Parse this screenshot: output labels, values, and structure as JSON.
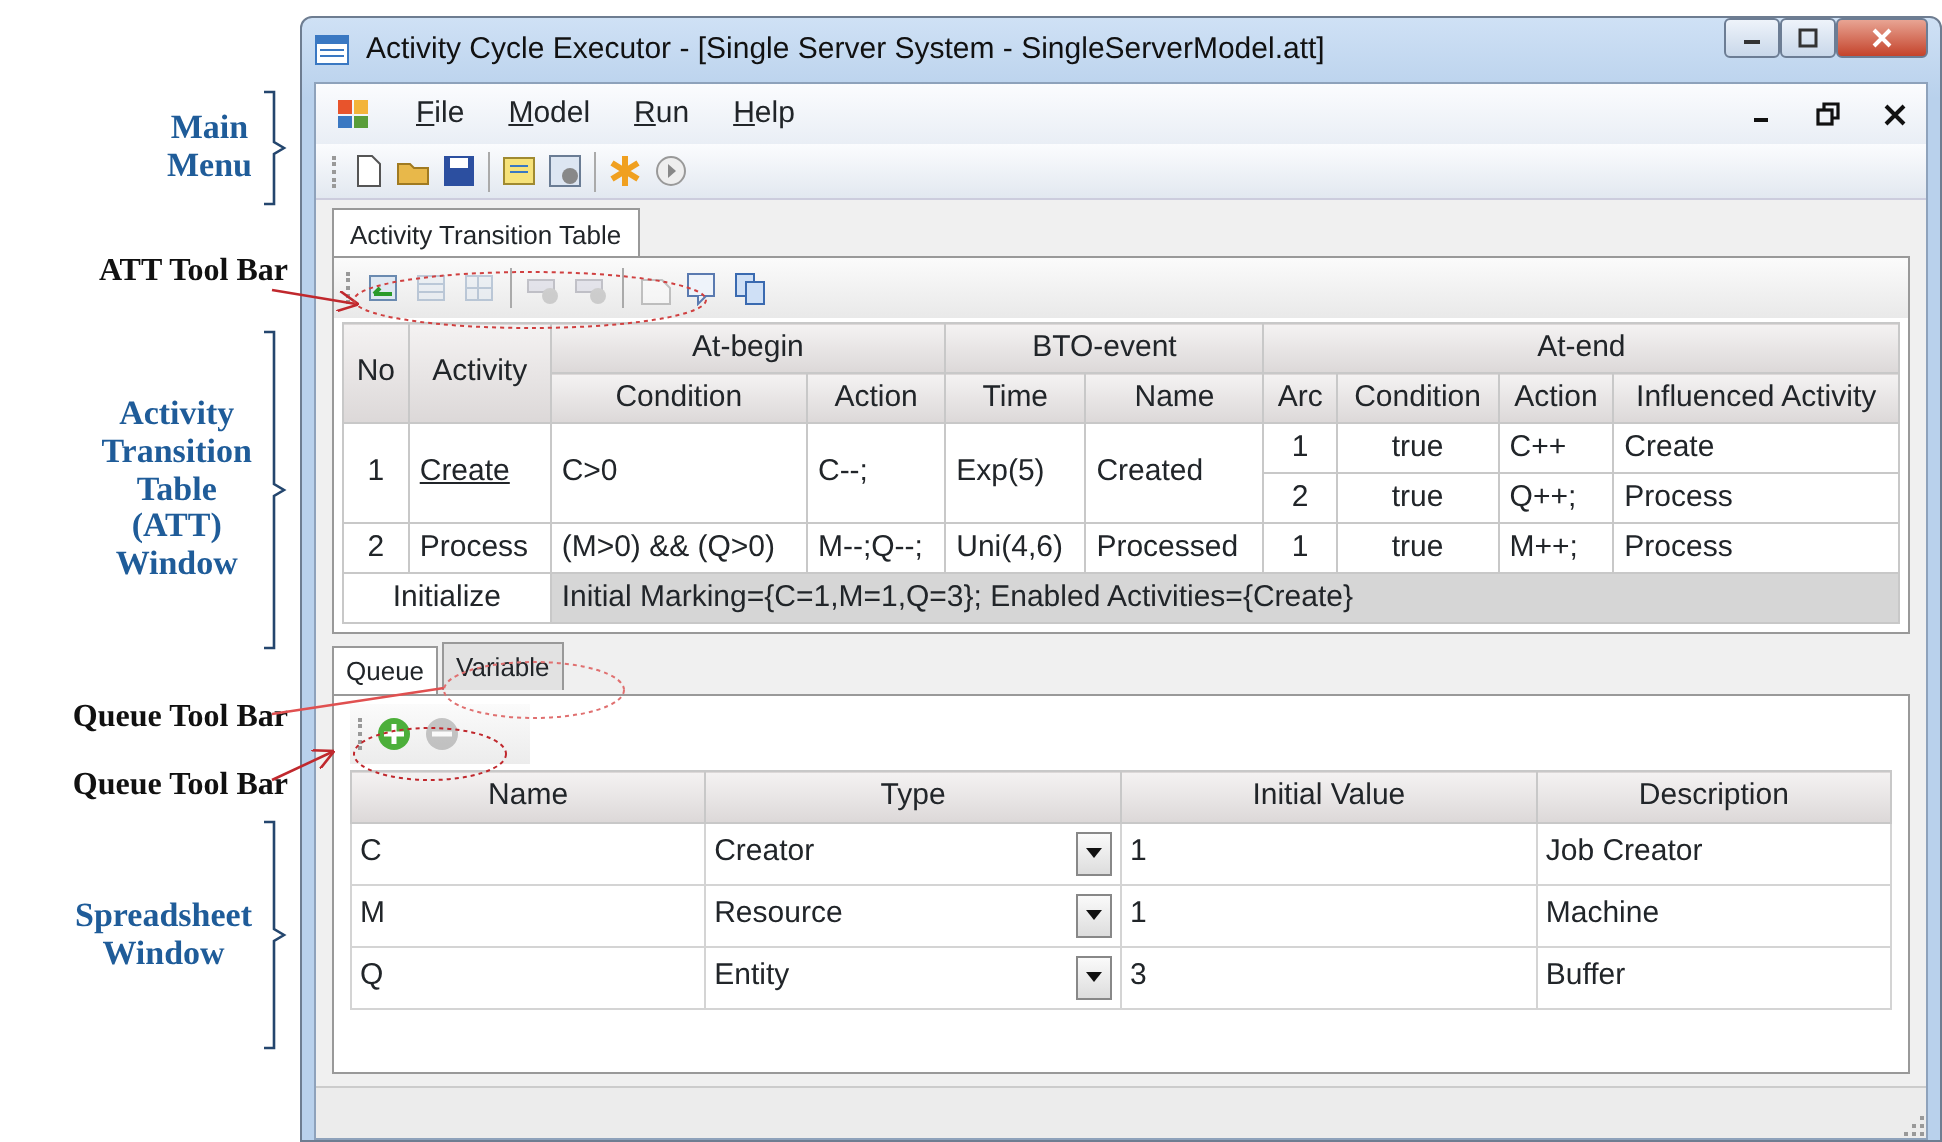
{
  "annotations": [
    {
      "kind": "brace",
      "lines": [
        "Main",
        "Menu"
      ]
    },
    {
      "kind": "arrow",
      "lines": [
        "ATT Tool Bar"
      ]
    },
    {
      "kind": "brace",
      "lines": [
        "Activity",
        "Transition",
        "Table",
        "(ATT)",
        "Window"
      ]
    },
    {
      "kind": "arrow",
      "lines": [
        "Queue Tool Bar"
      ]
    },
    {
      "kind": "arrow",
      "lines": [
        "Queue Tool Bar"
      ]
    },
    {
      "kind": "brace",
      "lines": [
        "Spreadsheet",
        "Window"
      ]
    }
  ],
  "window": {
    "title": "Activity Cycle Executor - [Single Server System - SingleServerModel.att]"
  },
  "menu": [
    "File",
    "Model",
    "Run",
    "Help"
  ],
  "doc_tabs": [
    {
      "label": "Activity Transition Table",
      "selected": true
    }
  ],
  "att_toolbar": [
    {
      "disabled": false
    },
    {
      "disabled": true
    },
    {
      "disabled": true
    },
    {
      "disabled": true
    },
    {
      "disabled": true
    },
    {
      "disabled": true
    },
    {
      "disabled": false
    },
    {
      "disabled": false
    }
  ],
  "att": {
    "group_headers": [
      "At-begin",
      "BTO-event",
      "At-end"
    ],
    "columns": [
      "No",
      "Activity",
      "Condition",
      "Action",
      "Time",
      "Name",
      "Arc",
      "Condition",
      "Action",
      "Influenced Activity"
    ],
    "rows": [
      {
        "no": "1",
        "activity": "Create",
        "focused": true,
        "condition": "C>0",
        "action": "C--;",
        "time": "Exp(5)",
        "name": "Created",
        "arcs": [
          {
            "arc": "1",
            "condition": "true",
            "action": "C++",
            "influenced": "Create"
          },
          {
            "arc": "2",
            "condition": "true",
            "action": "Q++;",
            "influenced": "Process"
          }
        ]
      },
      {
        "no": "2",
        "activity": "Process",
        "focused": false,
        "condition": "(M>0) && (Q>0)",
        "action": "M--;Q--;",
        "time": "Uni(4,6)",
        "name": "Processed",
        "arcs": [
          {
            "arc": "1",
            "condition": "true",
            "action": "M++;",
            "influenced": "Process"
          }
        ]
      }
    ],
    "initialize": {
      "label": "Initialize",
      "text": "Initial Marking={C=1,M=1,Q=3}; Enabled Activities={Create}"
    }
  },
  "queue_tabs": [
    {
      "label": "Queue",
      "selected": true
    },
    {
      "label": "Variable",
      "selected": false
    }
  ],
  "queue_toolbar": [
    {
      "disabled": false
    },
    {
      "disabled": true
    }
  ],
  "queue": {
    "columns": [
      "Name",
      "Type",
      "Initial Value",
      "Description"
    ],
    "rows": [
      {
        "name": "C",
        "type": "Creator",
        "initial_value": "1",
        "description": "Job Creator"
      },
      {
        "name": "M",
        "type": "Resource",
        "initial_value": "1",
        "description": "Machine"
      },
      {
        "name": "Q",
        "type": "Entity",
        "initial_value": "3",
        "description": "Buffer"
      }
    ]
  }
}
